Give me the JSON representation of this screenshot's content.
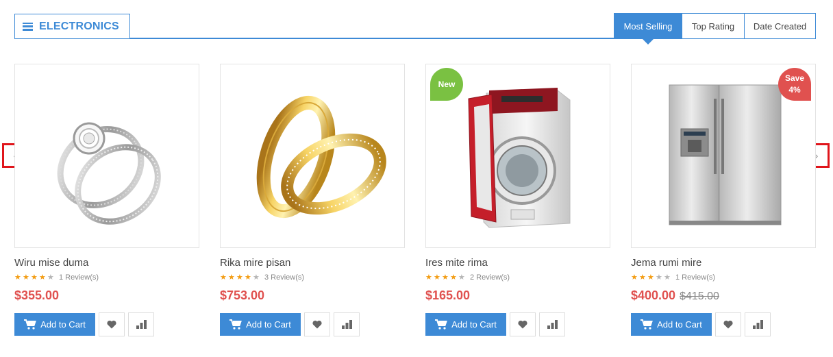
{
  "category": {
    "title": "ELECTRONICS",
    "icon": "hamburger-menu-icon"
  },
  "tabs": [
    {
      "label": "Most Selling",
      "active": true
    },
    {
      "label": "Top Rating",
      "active": false
    },
    {
      "label": "Date Created",
      "active": false
    }
  ],
  "nav": {
    "prev": "‹",
    "next": "›"
  },
  "colors": {
    "accent": "#3d8ad6",
    "price": "#e0514f",
    "new_badge": "#7ac142",
    "star": "#f39c12"
  },
  "products": [
    {
      "name": "Wiru mise duma",
      "rating": 3.5,
      "reviews": "1 Review(s)",
      "price": "$355.00",
      "old_price": "",
      "badge": "",
      "image": "diamond-ring-set",
      "cart_label": "Add to Cart"
    },
    {
      "name": "Rika mire pisan",
      "rating": 4.5,
      "reviews": "3 Review(s)",
      "price": "$753.00",
      "old_price": "",
      "badge": "",
      "image": "gold-wedding-bands",
      "cart_label": "Add to Cart"
    },
    {
      "name": "Ires mite rima",
      "rating": 4,
      "reviews": "2 Review(s)",
      "price": "$165.00",
      "old_price": "",
      "badge": "New",
      "image": "washing-machine",
      "cart_label": "Add to Cart"
    },
    {
      "name": "Jema rumi mire",
      "rating": 3,
      "reviews": "1 Review(s)",
      "price": "$400.00",
      "old_price": "$415.00",
      "badge": "Save\n4%",
      "image": "refrigerator",
      "cart_label": "Add to Cart"
    }
  ]
}
